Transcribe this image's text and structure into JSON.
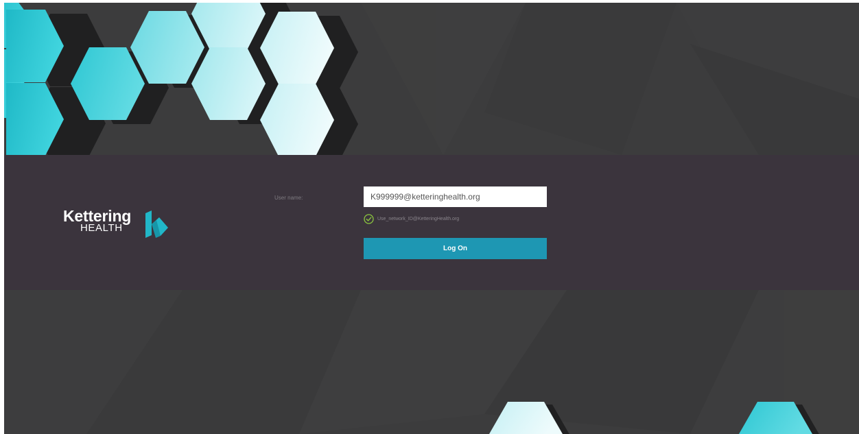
{
  "login": {
    "username_label": "User name:",
    "username_value": "K999999@ketteringhealth.org",
    "hint_text": "Use_network_ID@KetteringHealth.org",
    "logon_label": "Log On"
  },
  "brand": {
    "name": "Kettering",
    "subname": "HEALTH"
  },
  "icons": {
    "hint": "check-circle-icon",
    "logo_mark": "kettering-k-mark"
  },
  "colors": {
    "background": "#3c3c3d",
    "band": "#3b343d",
    "accent": "#1e97b3",
    "hex_dark": "#21c3d2",
    "hex_light": "#c9f1f5",
    "check": "#8cc63f"
  }
}
